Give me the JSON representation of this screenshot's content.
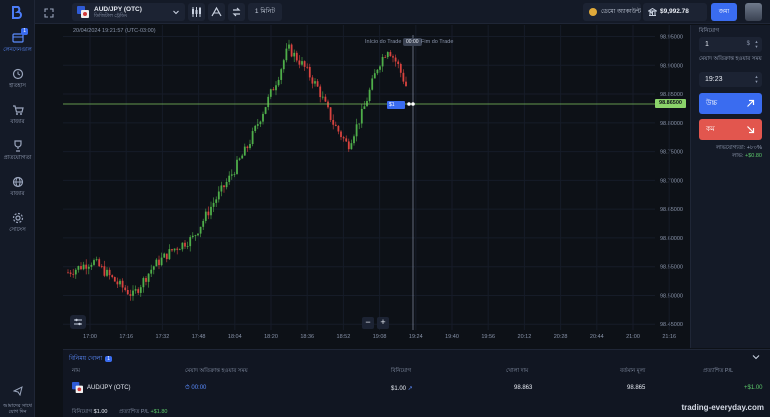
{
  "sidebar": {
    "items": [
      {
        "label": "লেনদেনগুলি",
        "badge": "1"
      },
      {
        "label": "ইতিহাস"
      },
      {
        "label": "বাজার"
      },
      {
        "label": "প্রতিযোগিতা"
      },
      {
        "label": "বাজার"
      },
      {
        "label": "সেটিংস"
      }
    ],
    "support_label": "আমাদের সাথে যোগ দিন"
  },
  "topbar": {
    "asset_name": "AUD/JPY (OTC)",
    "asset_sub": "ডিজিটাল ট্রেডিং",
    "timeframe": "1 মিনিট",
    "account_label": "ডেমো অ্যাকাউন্ট",
    "balance": "$9,992.78",
    "deposit_label": "জমা"
  },
  "chart": {
    "date_line": "20/04/2024  19:21:57 (UTC-03:00)",
    "trade_start_label": "Início do Trade",
    "trade_timer": "00:00",
    "trade_end_label": "Fim do Trade",
    "current_price": "98.86500",
    "trade_marker": "$1",
    "new_trade_badge": "+"
  },
  "chart_data": {
    "type": "candlestick",
    "y_ticks": [
      "98.95000",
      "98.90000",
      "98.85000",
      "98.80000",
      "98.75000",
      "98.70000",
      "98.65000",
      "98.60000",
      "98.55000",
      "98.50000",
      "98.45000"
    ],
    "x_ticks": [
      "17:00",
      "17:16",
      "17:32",
      "17:48",
      "18:04",
      "18:20",
      "18:36",
      "18:52",
      "19:08",
      "19:24",
      "19:40",
      "19:56",
      "20:12",
      "20:28",
      "20:44",
      "21:00",
      "21:16"
    ],
    "ylim": [
      98.44,
      98.97
    ]
  },
  "panel": {
    "amount_label": "বিনিয়োগ",
    "amount_value": "1",
    "amount_currency": "$",
    "time_label": "মেয়াদ অতিক্রান্ত হওয়ার সময়",
    "time_value": "19:23",
    "up_label": "উচ্চ",
    "down_label": "কম",
    "payout_label": "লাভযোগ্যতা: +৮০%",
    "profit_label": "লাভ:",
    "profit_value": "+$0.80"
  },
  "trades": {
    "tab_label": "বিনিময় খোলা",
    "tab_count": "1",
    "columns": [
      "নাম",
      "মেয়াদ অতিক্রান্ত হওয়ার সময়",
      "বিনিয়োগ",
      "খোলা দাম",
      "বর্তমান মূল্য",
      "প্রত্যাশিত P/L"
    ],
    "rows": [
      {
        "name": "AUD/JPY (OTC)",
        "expiry": "00:00",
        "amount": "$1.00",
        "open": "98.863",
        "current": "98.865",
        "pl": "+$1.00"
      }
    ],
    "summary_amount_label": "বিনিয়োগ",
    "summary_amount": "$1.00",
    "summary_pl_label": "প্রত্যাশিত P/L",
    "summary_pl": "+$1.80"
  },
  "watermark": "trading-everyday.com"
}
